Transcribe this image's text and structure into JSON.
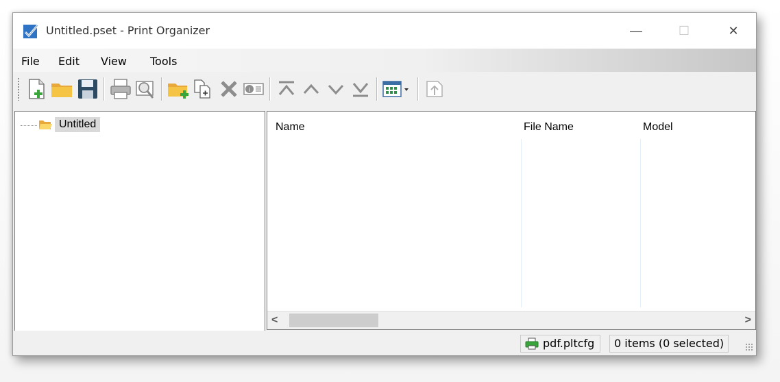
{
  "window": {
    "title": "Untitled.pset - Print Organizer",
    "controls": {
      "minimize": "—",
      "maximize": "☐",
      "close": "✕"
    }
  },
  "menu": [
    "File",
    "Edit",
    "View",
    "Tools"
  ],
  "toolbar": {
    "buttons": [
      "new-set-icon",
      "open-icon",
      "save-icon",
      "print-icon",
      "preview-icon",
      "new-folder-icon",
      "add-files-icon",
      "delete-icon",
      "properties-icon",
      "move-top-icon",
      "move-up-icon",
      "move-down-icon",
      "move-bottom-icon",
      "display-options-icon",
      "export-icon"
    ]
  },
  "tree": {
    "root_label": "Untitled"
  },
  "list": {
    "columns": [
      "Name",
      "File Name",
      "Model"
    ],
    "scroll_left": "<",
    "scroll_right": ">"
  },
  "status": {
    "printer": "pdf.pltcfg",
    "count": "0 items (0 selected)"
  },
  "colors": {
    "folder": "#f6c445",
    "blue_icon": "#1f6fbf",
    "green_plus": "#3aa53a",
    "toolbar_gray": "#8d8d8d"
  }
}
